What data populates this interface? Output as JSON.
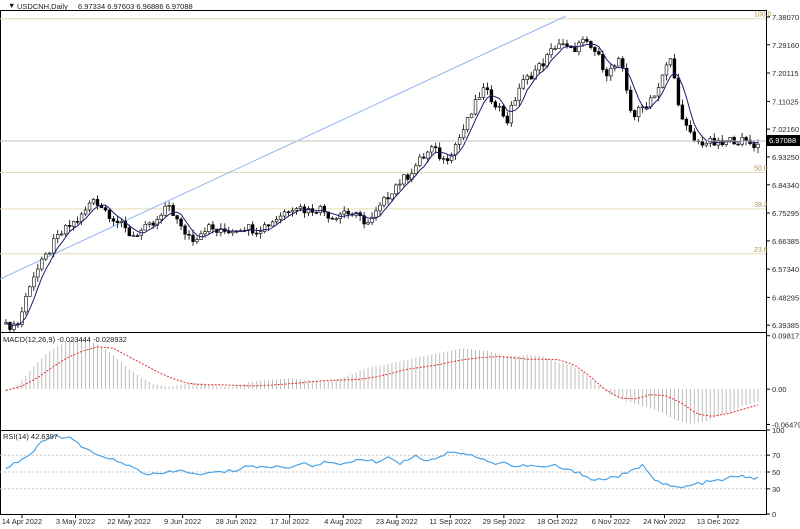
{
  "chart_data": [
    {
      "type": "candlestick",
      "title": "USDCNH,Daily",
      "ohlc_header": [
        "6.97334",
        "6.97603",
        "6.96886",
        "6.97088"
      ],
      "last_price": "6.97088",
      "y_ticks": [
        "7.38070",
        "7.29160",
        "7.20115",
        "7.11025",
        "7.02160",
        "6.93250",
        "6.84340",
        "6.75295",
        "6.66385",
        "6.57340",
        "6.48295",
        "6.39385"
      ],
      "ylim": [
        6.372,
        7.403
      ],
      "x_ticks": [
        "14 Apr 2022",
        "3 May 2022",
        "22 May 2022",
        "9 Jun 2022",
        "28 Jun 2022",
        "17 Jul 2022",
        "4 Aug 2022",
        "23 Aug 2022",
        "11 Sep 2022",
        "29 Sep 2022",
        "18 Oct 2022",
        "6 Nov 2022",
        "24 Nov 2022",
        "13 Dec 2022"
      ],
      "fibonacci_levels": [
        "100.0",
        "50.0",
        "38.2",
        "23.6"
      ],
      "close_anchors": [
        6.39,
        6.4,
        6.54,
        6.6,
        6.67,
        6.71,
        6.74,
        6.8,
        6.76,
        6.72,
        6.68,
        6.7,
        6.72,
        6.78,
        6.7,
        6.67,
        6.71,
        6.69,
        6.7,
        6.71,
        6.7,
        6.72,
        6.75,
        6.78,
        6.76,
        6.77,
        6.74,
        6.76,
        6.74,
        6.72,
        6.78,
        6.84,
        6.87,
        6.92,
        6.96,
        6.92,
        6.98,
        7.06,
        7.15,
        7.11,
        7.05,
        7.16,
        7.2,
        7.24,
        7.3,
        7.27,
        7.3,
        7.27,
        7.2,
        7.24,
        7.06,
        7.1,
        7.15,
        7.25,
        7.04,
        6.98,
        6.98,
        6.97,
        6.99,
        6.98,
        6.97
      ],
      "ma_period": 5
    },
    {
      "type": "histogram",
      "title": "MACD(12,26,9) -0.023444 -0.028932",
      "y_ticks": [
        "0.098171",
        "0.00",
        "-0.064791"
      ],
      "ylim": [
        -0.075,
        0.105
      ],
      "series": [
        {
          "name": "MACD",
          "anchors": [
            -0.005,
            0.01,
            0.04,
            0.065,
            0.082,
            0.093,
            0.092,
            0.08,
            0.062,
            0.04,
            0.022,
            0.01,
            0.004,
            0.008,
            0.012,
            0.01,
            0.005,
            0.004,
            0.012,
            0.016,
            0.018,
            0.02,
            0.018,
            0.015,
            0.014,
            0.02,
            0.03,
            0.04,
            0.044,
            0.05,
            0.055,
            0.06,
            0.065,
            0.07,
            0.075,
            0.072,
            0.07,
            0.062,
            0.06,
            0.064,
            0.06,
            0.05,
            0.045,
            0.03,
            0.01,
            -0.01,
            -0.02,
            -0.028,
            -0.035,
            -0.045,
            -0.058,
            -0.064,
            -0.06,
            -0.05,
            -0.04,
            -0.03,
            -0.023
          ]
        },
        {
          "name": "Signal",
          "anchors": [
            -0.002,
            0.005,
            0.02,
            0.04,
            0.058,
            0.07,
            0.078,
            0.075,
            0.06,
            0.045,
            0.03,
            0.018,
            0.01,
            0.008,
            0.008,
            0.007,
            0.006,
            0.007,
            0.009,
            0.011,
            0.014,
            0.016,
            0.017,
            0.018,
            0.022,
            0.028,
            0.036,
            0.04,
            0.044,
            0.05,
            0.055,
            0.058,
            0.06,
            0.058,
            0.055,
            0.055,
            0.054,
            0.045,
            0.025,
            0.0,
            -0.016,
            -0.018,
            -0.01,
            -0.012,
            -0.025,
            -0.045,
            -0.05,
            -0.045,
            -0.037,
            -0.029
          ]
        }
      ]
    },
    {
      "type": "line",
      "title": "RSI(14) 42.6397",
      "y_ticks": [
        "100",
        "70",
        "50",
        "30",
        "0"
      ],
      "ylim": [
        0,
        100
      ],
      "series": [
        {
          "name": "RSI",
          "anchors": [
            55,
            63,
            72,
            88,
            93,
            90,
            80,
            70,
            68,
            60,
            55,
            48,
            47,
            50,
            52,
            46,
            49,
            50,
            52,
            58,
            55,
            57,
            55,
            60,
            58,
            62,
            58,
            63,
            65,
            62,
            68,
            60,
            70,
            64,
            68,
            75,
            72,
            68,
            60,
            62,
            56,
            58,
            55,
            58,
            52,
            50,
            40,
            42,
            45,
            50,
            58,
            40,
            33,
            31,
            35,
            38,
            40,
            44,
            45,
            42
          ]
        }
      ]
    }
  ]
}
